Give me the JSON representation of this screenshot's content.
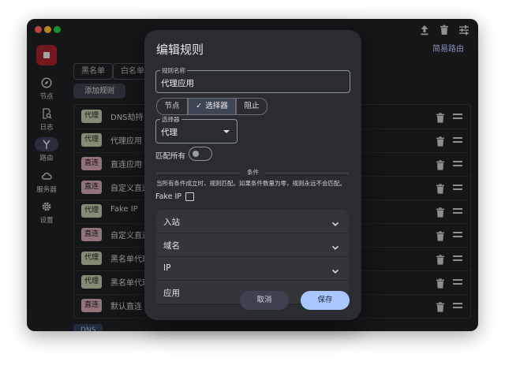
{
  "window": {
    "top_right_link": "简易路由",
    "top_icons": [
      "upload-icon",
      "trash-icon",
      "sliders-icon"
    ]
  },
  "sidebar": {
    "items": [
      {
        "label": "节点",
        "icon": "compass-icon"
      },
      {
        "label": "日志",
        "icon": "log-search-icon"
      },
      {
        "label": "路由",
        "icon": "route-fork-icon",
        "active": true
      },
      {
        "label": "服务器",
        "icon": "cloud-icon"
      },
      {
        "label": "设置",
        "icon": "gear-icon"
      }
    ]
  },
  "main": {
    "tabs": [
      "黑名单",
      "白名单"
    ],
    "add_rule_label": "添加规则",
    "rules": [
      {
        "badge": "代理",
        "type": "proxy",
        "name": "DNS劫持"
      },
      {
        "badge": "代理",
        "type": "proxy",
        "name": "代理应用"
      },
      {
        "badge": "直连",
        "type": "direct",
        "name": "直连应用"
      },
      {
        "badge": "直连",
        "type": "direct",
        "name": "自定义直连"
      },
      {
        "badge": "代理",
        "type": "proxy",
        "name": "Fake IP"
      },
      {
        "badge": "直连",
        "type": "direct",
        "name": "自定义直连"
      },
      {
        "badge": "代理",
        "type": "proxy",
        "name": "黑名单代理"
      },
      {
        "badge": "代理",
        "type": "proxy",
        "name": "黑名单代理"
      },
      {
        "badge": "直连",
        "type": "direct",
        "name": "默认直连"
      }
    ],
    "dns_tab_label": "DNS"
  },
  "dialog": {
    "title": "编辑规则",
    "rule_name": {
      "label": "规则名称",
      "value": "代理应用"
    },
    "segments": [
      {
        "label": "节点",
        "selected": false
      },
      {
        "label": "选择器",
        "selected": true
      },
      {
        "label": "阻止",
        "selected": false
      }
    ],
    "selector": {
      "label": "选择器",
      "value": "代理"
    },
    "match_all": {
      "label": "匹配所有",
      "on": false
    },
    "conditions": {
      "title": "条件",
      "description": "当所有条件成立时，规则匹配。如果条件数量为零，规则永远不会匹配。"
    },
    "fake_ip": {
      "label": "Fake IP",
      "checked": false
    },
    "accordions": [
      "入站",
      "域名",
      "IP",
      "应用"
    ],
    "cancel_label": "取消",
    "save_label": "保存"
  },
  "colors": {
    "accent": "#a9c7ff",
    "proxy_badge": "#b4c2a1",
    "direct_badge": "#caa0a8",
    "app_logo": "#a02228"
  }
}
